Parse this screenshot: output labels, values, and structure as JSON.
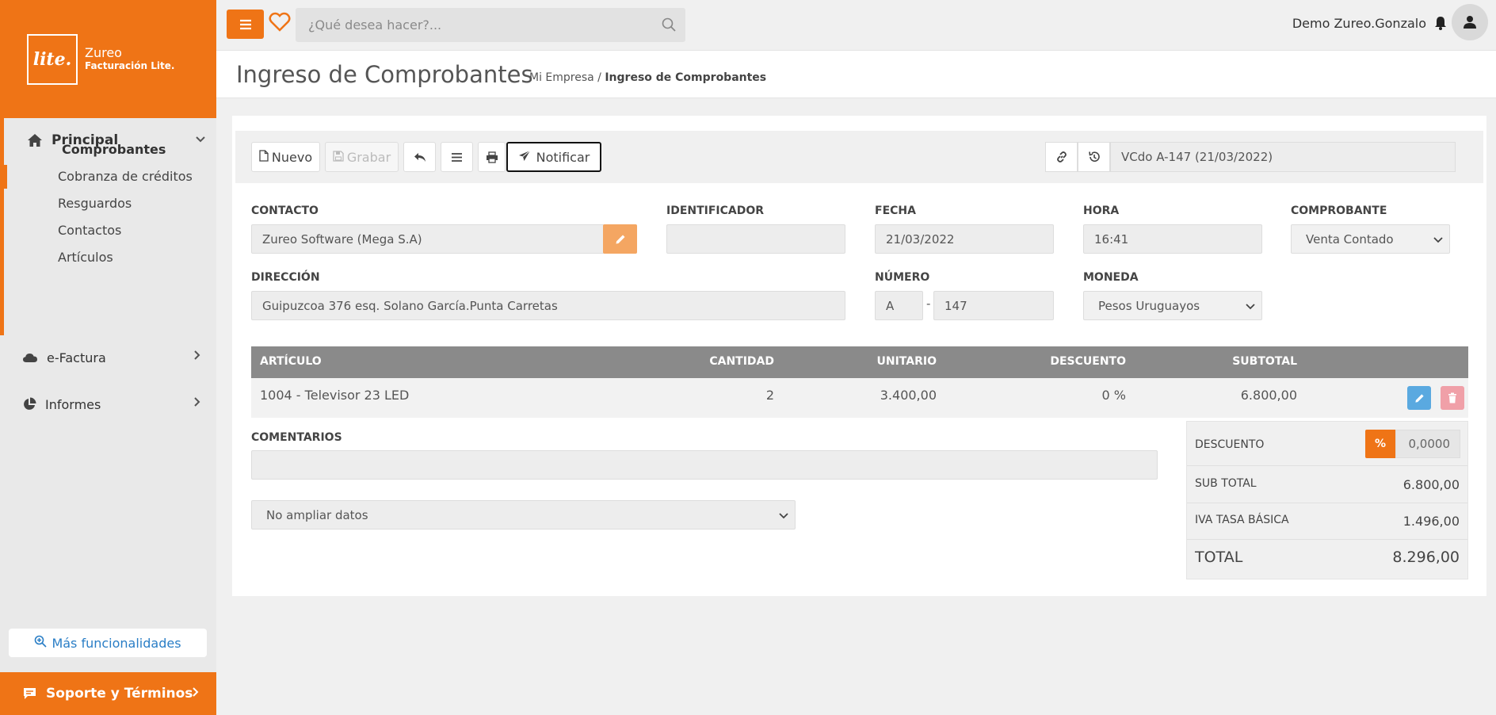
{
  "brand": {
    "logo": "lite.",
    "name": "Zureo",
    "product": "Facturación Lite."
  },
  "sidebar": {
    "principal": {
      "label": "Principal",
      "items": [
        {
          "label": "Comprobantes",
          "active": true
        },
        {
          "label": "Cobranza de créditos"
        },
        {
          "label": "Resguardos"
        },
        {
          "label": "Contactos"
        },
        {
          "label": "Artículos"
        }
      ]
    },
    "efactura": {
      "label": "e-Factura"
    },
    "informes": {
      "label": "Informes"
    },
    "more": "Más funcionalidades",
    "support": "Soporte y Términos"
  },
  "topbar": {
    "search_placeholder": "¿Qué desea hacer?...",
    "user": "Demo Zureo.Gonzalo"
  },
  "page": {
    "title": "Ingreso de Comprobantes",
    "crumb_root": "Mi Empresa /",
    "crumb_current": "Ingreso de Comprobantes"
  },
  "toolbar": {
    "new": "Nuevo",
    "save": "Grabar",
    "notify": "Notificar",
    "doc_ref": "VCdo A-147 (21/03/2022)"
  },
  "form": {
    "contacto": {
      "label": "CONTACTO",
      "value": "Zureo Software (Mega S.A)"
    },
    "identificador": {
      "label": "IDENTIFICADOR",
      "value": ""
    },
    "fecha": {
      "label": "FECHA",
      "value": "21/03/2022"
    },
    "hora": {
      "label": "HORA",
      "value": "16:41"
    },
    "comprobante": {
      "label": "COMPROBANTE",
      "value": "Venta Contado"
    },
    "direccion": {
      "label": "DIRECCIÓN",
      "value": "Guipuzcoa 376 esq. Solano García.Punta Carretas"
    },
    "numero": {
      "label": "NÚMERO",
      "serie": "A",
      "dash": "-",
      "value": "147"
    },
    "moneda": {
      "label": "MONEDA",
      "value": "Pesos Uruguayos"
    }
  },
  "table": {
    "headers": {
      "articulo": "ARTÍCULO",
      "cantidad": "CANTIDAD",
      "unitario": "UNITARIO",
      "descuento": "DESCUENTO",
      "subtotal": "SUBTOTAL"
    },
    "rows": [
      {
        "articulo": "1004 - Televisor 23 LED",
        "cantidad": "2",
        "unitario": "3.400,00",
        "descuento": "0 %",
        "subtotal": "6.800,00"
      }
    ]
  },
  "comentarios": {
    "label": "COMENTARIOS",
    "value": ""
  },
  "ampliar": {
    "value": "No ampliar datos"
  },
  "totals": {
    "descuento_label": "DESCUENTO",
    "descuento_pct": "%",
    "descuento_value": "0,0000",
    "subtotal_label": "SUB TOTAL",
    "subtotal_value": "6.800,00",
    "iva_label": "IVA TASA BÁSICA",
    "iva_value": "1.496,00",
    "total_label": "TOTAL",
    "total_value": "8.296,00"
  },
  "colors": {
    "accent": "#ef7416",
    "edit_blue": "#5aa9e0",
    "delete_red": "#f0a0a8"
  }
}
